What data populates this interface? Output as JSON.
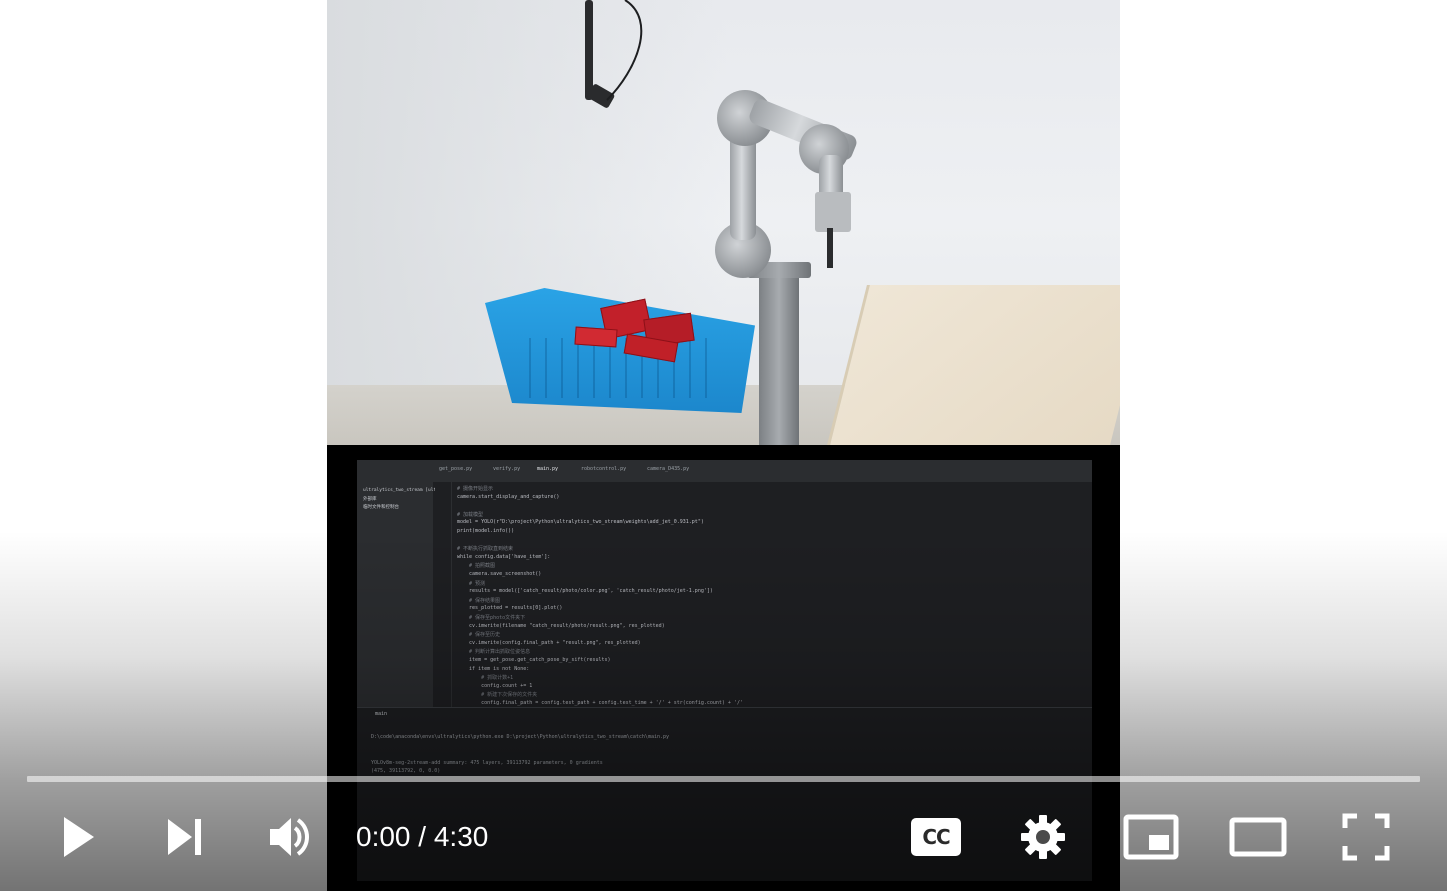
{
  "player": {
    "time": {
      "current": "0:00",
      "separator": " / ",
      "duration": "4:30"
    },
    "progress_fraction": 0.0,
    "colors": {
      "progress_played": "#ff0000",
      "progress_track": "#ffffff",
      "icon": "#ffffff"
    },
    "controls": [
      {
        "name": "play-button",
        "icon": "play-icon"
      },
      {
        "name": "next-button",
        "icon": "next-icon"
      },
      {
        "name": "volume-button",
        "icon": "volume-icon"
      },
      {
        "name": "subtitles-button",
        "icon": "cc-icon"
      },
      {
        "name": "settings-button",
        "icon": "gear-icon"
      },
      {
        "name": "miniplayer-button",
        "icon": "miniplayer-icon"
      },
      {
        "name": "theater-mode-button",
        "icon": "theater-icon"
      },
      {
        "name": "fullscreen-button",
        "icon": "fullscreen-icon"
      }
    ],
    "cc_label": "CC"
  },
  "video": {
    "ide": {
      "tabs": [
        "get_pose.py",
        "verify.py",
        "main.py",
        "robotcontrol.py",
        "camera_D435.py"
      ],
      "tree": [
        "ultralytics_two_stream [ult",
        "外部库",
        "临时文件和控制台"
      ],
      "code_lines": [
        {
          "text": "# 摄像开始显示",
          "comment": true
        },
        {
          "text": "camera.start_display_and_capture()",
          "comment": false
        },
        {
          "text": "",
          "comment": false
        },
        {
          "text": "# 加载模型",
          "comment": true
        },
        {
          "text": "model = YOLO(r\"D:\\project\\Python\\ultralytics_two_stream\\weights\\add_jet_0.931.pt\")",
          "comment": false
        },
        {
          "text": "print(model.info())",
          "comment": false
        },
        {
          "text": "",
          "comment": false
        },
        {
          "text": "# 不断执行抓取直到结束",
          "comment": true
        },
        {
          "text": "while config.data['have_item']:",
          "comment": false
        },
        {
          "text": "    # 拍照截图",
          "comment": true
        },
        {
          "text": "    camera.save_screenshot()",
          "comment": false
        },
        {
          "text": "    # 预测",
          "comment": true
        },
        {
          "text": "    results = model(['catch_result/photo/color.png', 'catch_result/photo/jet-1.png'])",
          "comment": false
        },
        {
          "text": "    # 保存结果图",
          "comment": true
        },
        {
          "text": "    res_plotted = results[0].plot()",
          "comment": false
        },
        {
          "text": "    # 保存至photo文件夹下",
          "comment": true
        },
        {
          "text": "    cv.imwrite(filename \"catch_result/photo/result.png\", res_plotted)",
          "comment": false
        },
        {
          "text": "    # 保存至历史",
          "comment": true
        },
        {
          "text": "    cv.imwrite(config.final_path + \"result.png\", res_plotted)",
          "comment": false
        },
        {
          "text": "    # 判断计算出抓取位姿信息",
          "comment": true
        },
        {
          "text": "    item = get_pose.get_catch_pose_by_sift(results)",
          "comment": false
        },
        {
          "text": "    if item is not None:",
          "comment": false
        },
        {
          "text": "        # 抓取计数+1",
          "comment": true
        },
        {
          "text": "        config.count += 1",
          "comment": false
        },
        {
          "text": "        # 新建下次保存的文件夹",
          "comment": true
        },
        {
          "text": "        config.final_path = config.test_path + config.test_time + '/' + str(config.count) + '/'",
          "comment": false
        }
      ],
      "run_tab": "main",
      "run_lines": [
        "D:\\code\\anaconda\\envs\\ultralytics\\python.exe D:\\project\\Python\\ultralytics_two_stream\\catch\\main.py",
        "",
        "",
        "YOLOv8m-seg-2stream-add summary: 475 layers, 39113792 parameters, 0 gradients",
        "(475, 39113792, 0, 0.0)"
      ]
    }
  }
}
